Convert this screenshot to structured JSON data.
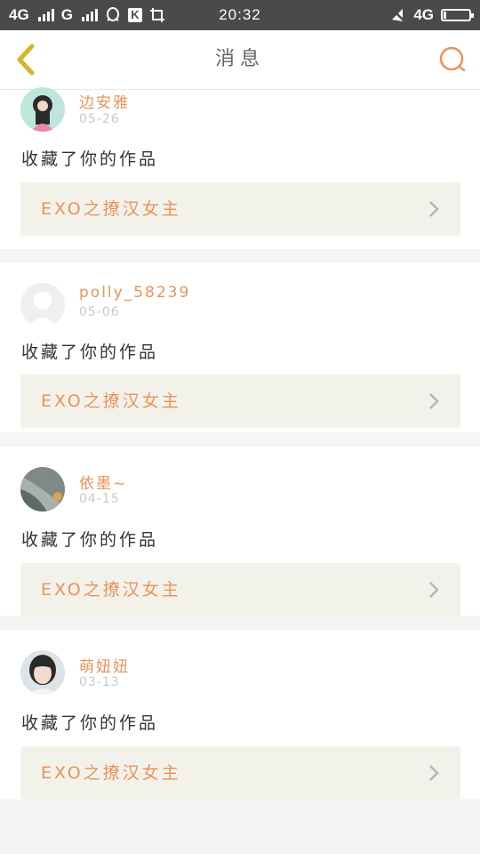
{
  "status_bar": {
    "left_text_1": "4G",
    "left_text_2": "G",
    "time": "20:32",
    "right_text": "4G",
    "icons": [
      "signal-icon",
      "qq-icon",
      "k-icon",
      "screenshot-icon",
      "mute-icon",
      "battery-icon"
    ],
    "k_label": "K",
    "battery_level": 0.1
  },
  "header": {
    "title": "消息",
    "back_icon": "back-chevron-icon",
    "search_icon": "search-icon"
  },
  "colors": {
    "accent": "#e8935a",
    "back_icon": "#d6b52a",
    "work_box_bg": "#f2f2ea",
    "page_bg": "#f5f5f3"
  },
  "messages": [
    {
      "username": "边安雅",
      "date": "05-26",
      "action": "收藏了你的作品",
      "work_title": "EXO之撩汉女主",
      "avatar": "avatar-photo"
    },
    {
      "username": "polly_58239",
      "date": "05-06",
      "action": "收藏了你的作品",
      "work_title": "EXO之撩汉女主",
      "avatar": "default-avatar"
    },
    {
      "username": "依墨~",
      "date": "04-15",
      "action": "收藏了你的作品",
      "work_title": "EXO之撩汉女主",
      "avatar": "avatar-photo"
    },
    {
      "username": "萌妞妞",
      "date": "03-13",
      "action": "收藏了你的作品",
      "work_title": "EXO之撩汉女主",
      "avatar": "avatar-photo"
    }
  ]
}
